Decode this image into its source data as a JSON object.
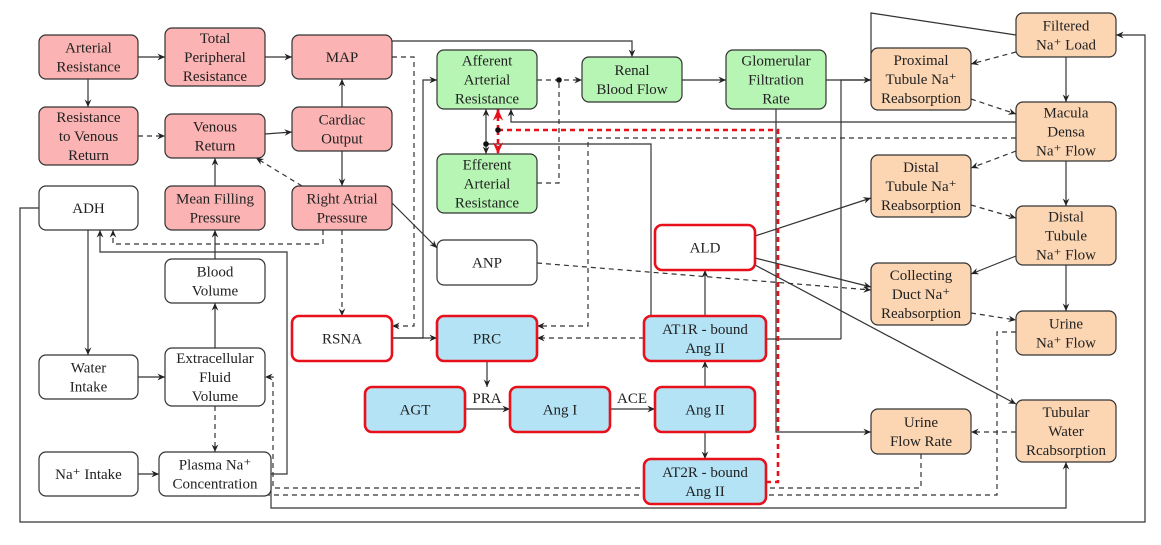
{
  "colors": {
    "cardiovascular": "#fbb3b3",
    "renal_hemodynamics": "#b7f5b5",
    "tubular": "#fcd6b3",
    "raas": "#b3e3f5",
    "neutral": "#ffffff",
    "highlight_border": "#e8101a"
  },
  "nodes": [
    {
      "id": "arterial_resistance",
      "lines": [
        "Arterial",
        "Resistance"
      ],
      "group": "cardiovascular"
    },
    {
      "id": "total_peripheral_resistance",
      "lines": [
        "Total",
        "Peripheral",
        "Resistance"
      ],
      "group": "cardiovascular"
    },
    {
      "id": "map",
      "lines": [
        "MAP"
      ],
      "group": "cardiovascular"
    },
    {
      "id": "resistance_venous_return",
      "lines": [
        "Resistance",
        "to Venous",
        "Return"
      ],
      "group": "cardiovascular"
    },
    {
      "id": "venous_return",
      "lines": [
        "Venous",
        "Return"
      ],
      "group": "cardiovascular"
    },
    {
      "id": "cardiac_output",
      "lines": [
        "Cardiac",
        "Output"
      ],
      "group": "cardiovascular"
    },
    {
      "id": "adh",
      "lines": [
        "ADH"
      ],
      "group": "neutral"
    },
    {
      "id": "mean_filling_pressure",
      "lines": [
        "Mean Filling",
        "Pressure"
      ],
      "group": "cardiovascular"
    },
    {
      "id": "right_atrial_pressure",
      "lines": [
        "Right Atrial",
        "Pressure"
      ],
      "group": "cardiovascular"
    },
    {
      "id": "blood_volume",
      "lines": [
        "Blood",
        "Volume"
      ],
      "group": "neutral"
    },
    {
      "id": "water_intake",
      "lines": [
        "Water",
        "Intake"
      ],
      "group": "neutral"
    },
    {
      "id": "ecf_volume",
      "lines": [
        "Extracellular",
        "Fluid",
        "Volume"
      ],
      "group": "neutral"
    },
    {
      "id": "na_intake",
      "lines": [
        "Na⁺ Intake"
      ],
      "group": "neutral"
    },
    {
      "id": "plasma_na",
      "lines": [
        "Plasma Na⁺",
        "Concentration"
      ],
      "group": "neutral"
    },
    {
      "id": "afferent",
      "lines": [
        "Afferent",
        "Arterial",
        "Resistance"
      ],
      "group": "renal_hemodynamics"
    },
    {
      "id": "efferent",
      "lines": [
        "Efferent",
        "Arterial",
        "Resistance"
      ],
      "group": "renal_hemodynamics"
    },
    {
      "id": "renal_blood_flow",
      "lines": [
        "Renal",
        "Blood Flow"
      ],
      "group": "renal_hemodynamics"
    },
    {
      "id": "gfr",
      "lines": [
        "Glomerular",
        "Filtration",
        "Rate"
      ],
      "group": "renal_hemodynamics"
    },
    {
      "id": "anp",
      "lines": [
        "ANP"
      ],
      "group": "neutral"
    },
    {
      "id": "ald",
      "lines": [
        "ALD"
      ],
      "group": "neutral",
      "highlight": true
    },
    {
      "id": "rsna",
      "lines": [
        "RSNA"
      ],
      "group": "neutral",
      "highlight": true
    },
    {
      "id": "prc",
      "lines": [
        "PRC"
      ],
      "group": "raas",
      "highlight": true
    },
    {
      "id": "at1r",
      "lines": [
        "AT1R - bound",
        "Ang II"
      ],
      "group": "raas",
      "highlight": true
    },
    {
      "id": "agt",
      "lines": [
        "AGT"
      ],
      "group": "raas",
      "highlight": true
    },
    {
      "id": "ang1",
      "lines": [
        "Ang I"
      ],
      "group": "raas",
      "highlight": true
    },
    {
      "id": "ang2",
      "lines": [
        "Ang II"
      ],
      "group": "raas",
      "highlight": true
    },
    {
      "id": "at2r",
      "lines": [
        "AT2R - bound",
        "Ang II"
      ],
      "group": "raas",
      "highlight": true
    },
    {
      "id": "filtered_na",
      "lines": [
        "Filtered",
        "Na⁺ Load"
      ],
      "group": "tubular"
    },
    {
      "id": "proximal",
      "lines": [
        "Proximal",
        "Tubule Na⁺",
        "Reabsorption"
      ],
      "group": "tubular"
    },
    {
      "id": "macula_densa",
      "lines": [
        "Macula",
        "Densa",
        "Na⁺ Flow"
      ],
      "group": "tubular"
    },
    {
      "id": "distal_reab",
      "lines": [
        "Distal",
        "Tubule Na⁺",
        "Reabsorption"
      ],
      "group": "tubular"
    },
    {
      "id": "distal_flow",
      "lines": [
        "Distal",
        "Tubule",
        "Na⁺ Flow"
      ],
      "group": "tubular"
    },
    {
      "id": "collecting_duct",
      "lines": [
        "Collecting",
        "Duct Na⁺",
        "Reabsorption"
      ],
      "group": "tubular"
    },
    {
      "id": "urine_na",
      "lines": [
        "Urine",
        "Na⁺ Flow"
      ],
      "group": "tubular"
    },
    {
      "id": "urine_flow",
      "lines": [
        "Urine",
        "Flow Rate"
      ],
      "group": "tubular"
    },
    {
      "id": "tubular_water",
      "lines": [
        "Tubular",
        "Water",
        "Rcabsorption"
      ],
      "group": "tubular"
    }
  ],
  "edge_labels": {
    "pra": "PRA",
    "ace": "ACE"
  }
}
